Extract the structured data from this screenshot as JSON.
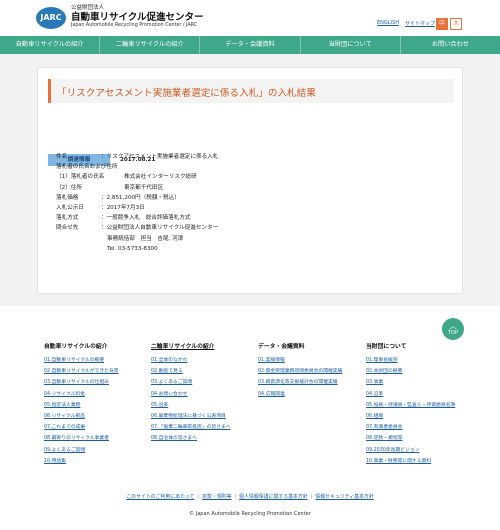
{
  "header": {
    "logo_mark": "JARC",
    "org_small": "公益財団法人",
    "org_name": "自動車リサイクル促進センター",
    "org_en": "Japan Automobile Recycling Promotion Center / JARC",
    "english": "ENGLISH",
    "sitemap": "サイトマップ",
    "font_mid": "中",
    "font_large": "大"
  },
  "nav": {
    "items": [
      "自動車リサイクルの紹介",
      "二輪車リサイクルの紹介",
      "データ・会議資料",
      "当財団について",
      "お問い合わせ"
    ]
  },
  "main": {
    "title": "「リスクアセスメント実施業者選定に係る入札」の入札結果",
    "badge": "調達情報",
    "date": "2017.08.21",
    "rows": [
      {
        "label": "件名",
        "value": "：リスクアセスメント実施業者選定に係る入札"
      },
      {
        "label": "落札者の氏名および住所",
        "value": ""
      },
      {
        "label": "（1）落札者の氏名",
        "value": "株式会社インターリスク総研"
      },
      {
        "label": "（2）住所",
        "value": "東京都千代田区"
      },
      {
        "label": "落札価格",
        "value": "：2,851,200円（税額・税込）"
      },
      {
        "label": "入札公示日",
        "value": "：2017年7月3日"
      },
      {
        "label": "落札方式",
        "value": "：一般競争入札　総合評価落札方式"
      },
      {
        "label": "問合せ先",
        "value": "：公益財団法人自動車リサイクル促進センター"
      }
    ],
    "contact_line2": "事務統括部　担当　吉尾, 河津",
    "contact_tel": "Tel. 03-5733-8300"
  },
  "footer": {
    "top_button": "TOP",
    "col1": {
      "head": "自動車リサイクルの紹介",
      "links": [
        "01.自動車リサイクルの概要",
        "02.自動車リサイクルができた背景",
        "03.自動車リサイクルの仕組み",
        "04.リサイクル料金",
        "05.指定法人業務",
        "06.リサイクル部品",
        "07.これまでの成果",
        "08.最寄りのリサイクル事業者",
        "09.よくあるご質問",
        "10.用語集"
      ]
    },
    "col2": {
      "head": "二輪車リサイクルの紹介",
      "links": [
        "01.全体のながれ",
        "02.動画で見る",
        "03.よくあるご質問",
        "04.お問い合わせ",
        "05.沿革",
        "06.廃棄物処理法に基づく公表項目",
        "07.「廃棄二輪車取扱店」の皆さまへ",
        "08.自治体の皆さまへ"
      ]
    },
    "col3": {
      "head": "データ・会議資料",
      "links": [
        "01.実績情報",
        "02.資金管理業務諮問委員会の開催実績",
        "03.再資源化等支援検討会の開催実績",
        "04.広報関連"
      ]
    },
    "col4": {
      "head": "当財団について",
      "links": [
        "01.理事長挨拶",
        "02.本財団の概要",
        "03.事業",
        "04.沿革",
        "05.役員・評議員・監査人・評価委員名簿",
        "06.組織",
        "07.有識者委員会",
        "08.定款・規程等",
        "09.2030年長期ビジョン",
        "10.事業・財務等に関する資料"
      ]
    },
    "bottom_links": [
      "このサイトのご利用にあたって",
      "定款・規則等",
      "個人情報保護に関する基本方針",
      "情報セキュリティ基本方針"
    ],
    "copyright": "© Japan Automobile Recycling Promotion Center"
  }
}
